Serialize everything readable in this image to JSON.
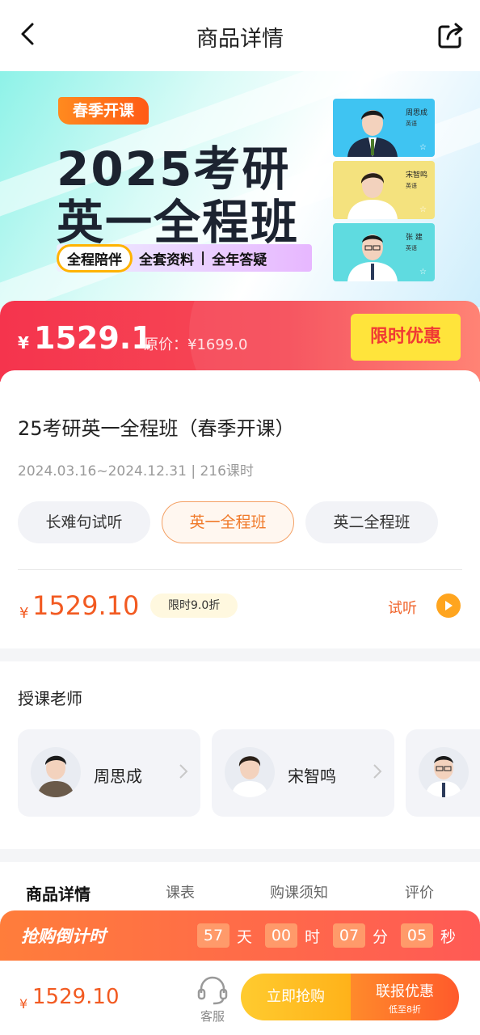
{
  "header": {
    "title": "商品详情",
    "back_icon": "chevron-left-icon",
    "share_icon": "share-icon"
  },
  "banner": {
    "season_tag": "春季开课",
    "title_line1": "2025考研",
    "title_line2": "英一全程班",
    "features": [
      "全程陪伴",
      "全套资料",
      "全年答疑"
    ],
    "feature_separator": "|",
    "teacher_cards": [
      {
        "name": "周思成",
        "subject": "英语",
        "bg": "#3fc4f2"
      },
      {
        "name": "宋智鸣",
        "subject": "英语",
        "bg": "#f4e27e"
      },
      {
        "name": "张 建",
        "subject": "英语",
        "bg": "#5fdbe0"
      }
    ]
  },
  "price_bar": {
    "currency": "¥",
    "price": "1529.1",
    "original_label": "原价：¥1699.0",
    "promo_label": "限时优惠"
  },
  "course": {
    "title": "25考研英一全程班（春季开课）",
    "meta": "2024.03.16~2024.12.31 | 216课时",
    "options": [
      {
        "label": "长难句试听",
        "active": false
      },
      {
        "label": "英一全程班",
        "active": true
      },
      {
        "label": "英二全程班",
        "active": false
      }
    ],
    "currency": "¥",
    "price": "1529.10",
    "discount": "限时9.0折",
    "trial_label": "试听"
  },
  "teachers_section": {
    "title": "授课老师",
    "teachers": [
      {
        "name": "周思成"
      },
      {
        "name": "宋智鸣"
      },
      {
        "name": ""
      }
    ]
  },
  "tabs": [
    {
      "label": "商品详情",
      "active": true
    },
    {
      "label": "课表",
      "active": false
    },
    {
      "label": "购课须知",
      "active": false
    },
    {
      "label": "评价",
      "active": false
    }
  ],
  "countdown": {
    "label": "抢购倒计时",
    "days": "57",
    "days_unit": "天",
    "hours": "00",
    "hours_unit": "时",
    "minutes": "07",
    "minutes_unit": "分",
    "seconds": "05",
    "seconds_unit": "秒"
  },
  "bottom_bar": {
    "currency": "¥",
    "price": "1529.10",
    "service_label": "客服",
    "buy_label": "立即抢购",
    "combo_label": "联报优惠",
    "combo_sub": "低至8折"
  },
  "colors": {
    "accent_red": "#f5344d",
    "accent_orange": "#f25a21",
    "promo_yellow": "#ffe43b"
  }
}
